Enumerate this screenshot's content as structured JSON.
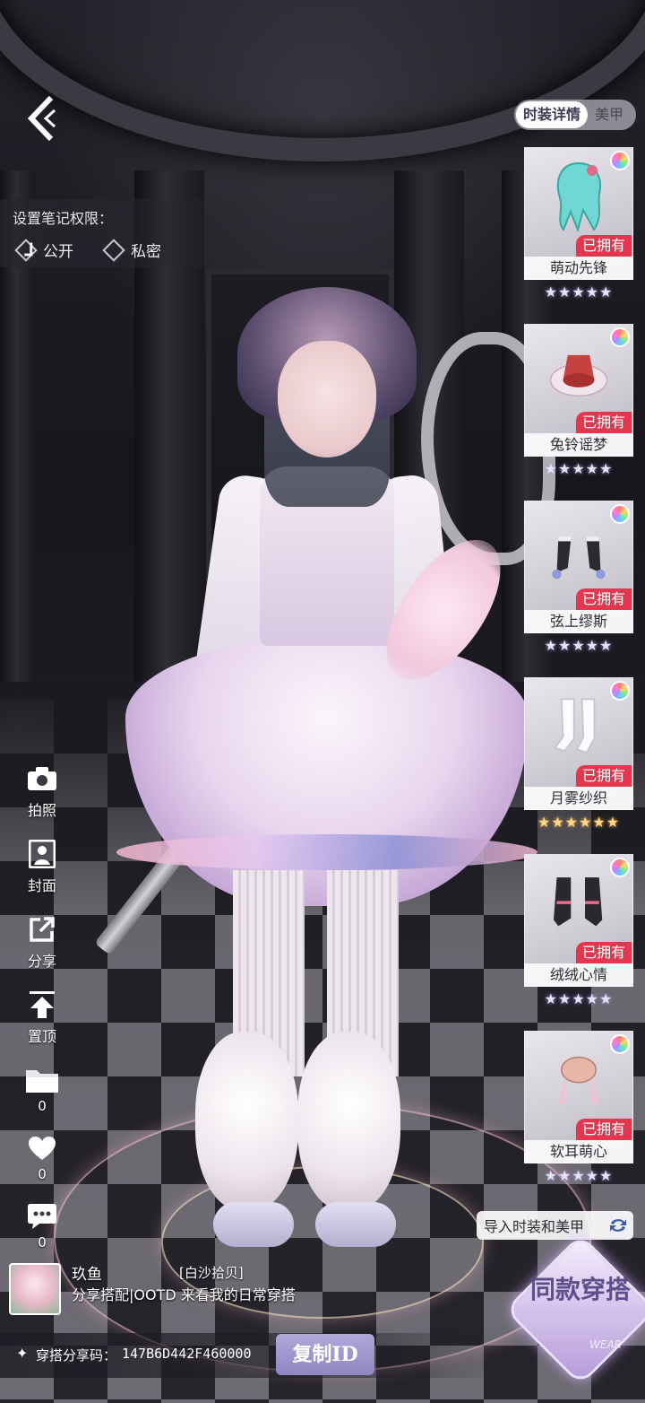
{
  "permissions": {
    "title": "设置笔记权限：",
    "options": [
      {
        "label": "公开",
        "checked": true
      },
      {
        "label": "私密",
        "checked": false
      }
    ]
  },
  "tabs": [
    {
      "label": "时装详情",
      "active": true
    },
    {
      "label": "美甲",
      "active": false
    }
  ],
  "items": [
    {
      "name": "萌动先锋",
      "status": "已拥有",
      "stars": "★★★★★",
      "rarity": "silver",
      "icon": "hair-icon"
    },
    {
      "name": "兔铃谣梦",
      "status": "已拥有",
      "stars": "★★★★★",
      "rarity": "silver",
      "icon": "dress-icon"
    },
    {
      "name": "弦上缪斯",
      "status": "已拥有",
      "stars": "★★★★★",
      "rarity": "silver",
      "icon": "gloves-icon"
    },
    {
      "name": "月雾纱织",
      "status": "已拥有",
      "stars": "★★★★★★",
      "rarity": "gold",
      "icon": "socks-icon"
    },
    {
      "name": "绒绒心情",
      "status": "已拥有",
      "stars": "★★★★★",
      "rarity": "silver",
      "icon": "shoes-icon"
    },
    {
      "name": "软耳萌心",
      "status": "已拥有",
      "stars": "★★★★★",
      "rarity": "silver",
      "icon": "hair-accessory-icon"
    }
  ],
  "actions": {
    "photo": "拍照",
    "cover": "封面",
    "share": "分享",
    "pin": "置顶",
    "favorite_count": "0",
    "like_count": "0",
    "comment_count": "0"
  },
  "import_label": "导入时装和美甲",
  "same_outfit": {
    "label": "同款穿搭",
    "sub": "WEAR"
  },
  "author": {
    "name": "玖鱼",
    "tag": "[白沙拾贝]",
    "desc": "分享搭配|OOTD 来看我的日常穿搭"
  },
  "share": {
    "code_label": "穿搭分享码：",
    "code": "147B6D442F460000",
    "copy_label": "复制ID"
  },
  "colors": {
    "owned_badge": "#e4374f",
    "copy_button": "#9a92cb",
    "tab_active_text": "#3f3a57"
  }
}
